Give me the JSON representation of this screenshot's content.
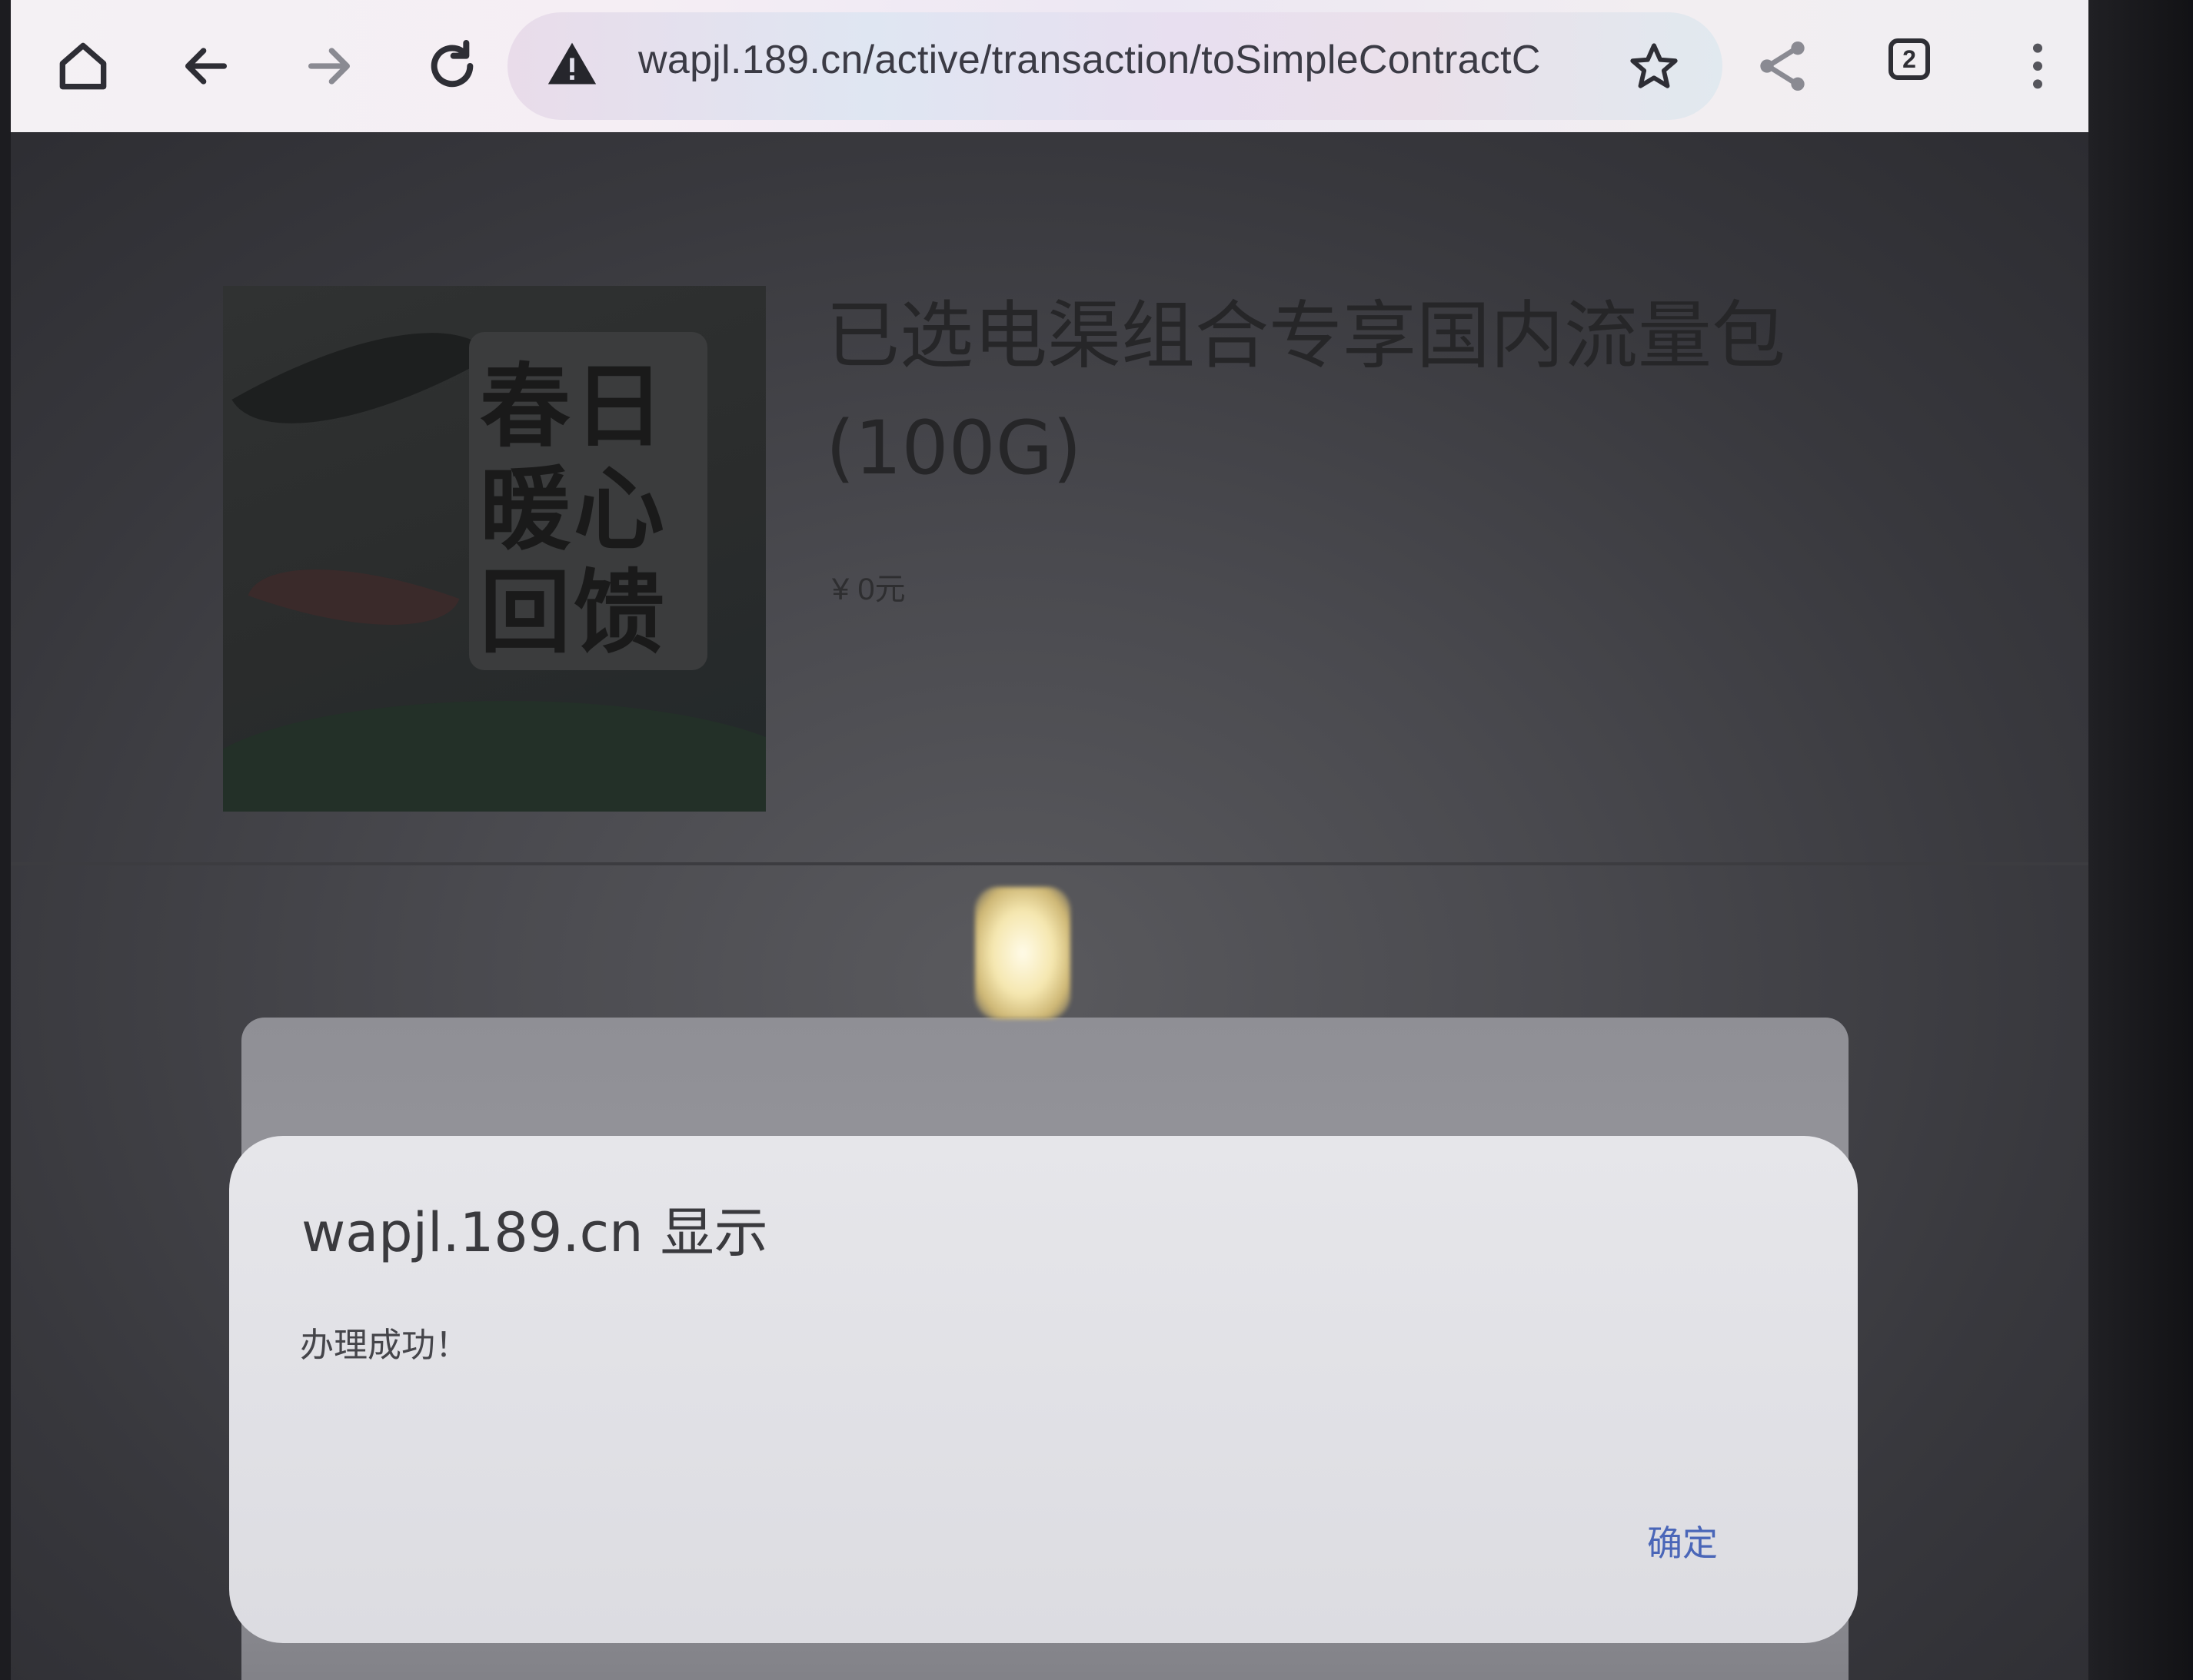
{
  "browser": {
    "url": "wapjl.189.cn/active/transaction/toSimpleContractC",
    "tab_count": "2",
    "icons": [
      "home-icon",
      "back-icon",
      "forward-icon",
      "reload-icon",
      "warning-icon",
      "bookmark-star-icon",
      "share-icon",
      "tab-switcher-icon",
      "more-menu-icon"
    ]
  },
  "page": {
    "product": {
      "image_text": "春日暖心回馈",
      "title": "已选电渠组合专享国内流量包(100G)",
      "price": "¥ 0元"
    }
  },
  "dialog": {
    "title": "wapjl.189.cn 显示",
    "message": "办理成功！",
    "ok_label": "确定"
  },
  "colors": {
    "accent": "#4a66b8",
    "dialog_background": "#e2e2e7"
  }
}
